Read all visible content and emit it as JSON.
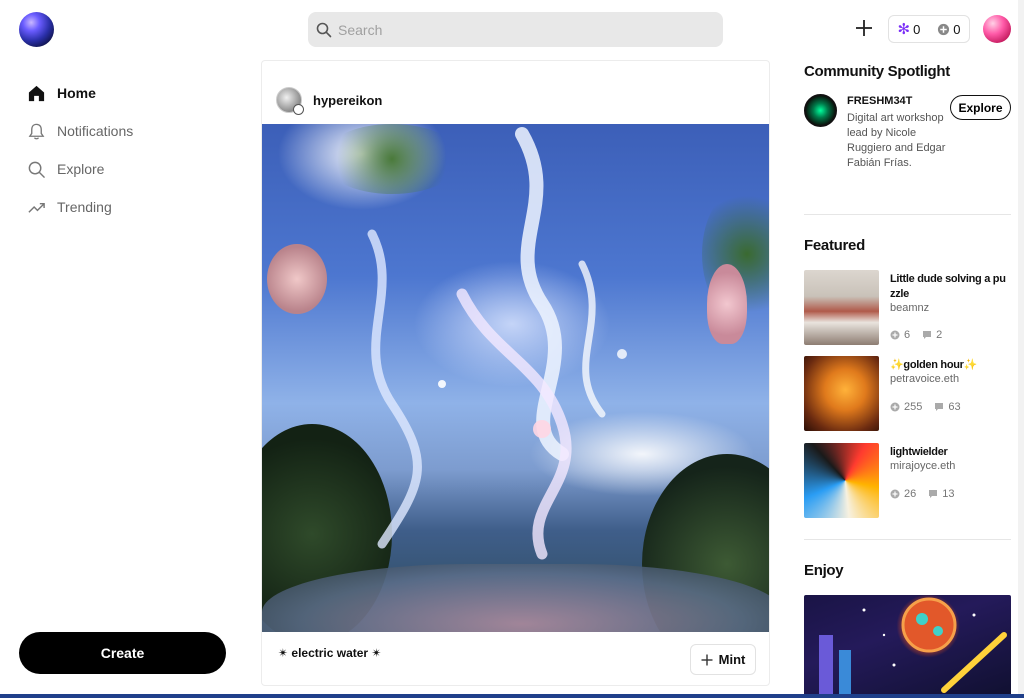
{
  "search": {
    "placeholder": "Search"
  },
  "header": {
    "stars_count": "0",
    "plus_count": "0"
  },
  "nav": {
    "items": [
      {
        "label": "Home",
        "icon": "home-icon",
        "active": true
      },
      {
        "label": "Notifications",
        "icon": "bell-icon",
        "active": false
      },
      {
        "label": "Explore",
        "icon": "search-icon",
        "active": false
      },
      {
        "label": "Trending",
        "icon": "trending-icon",
        "active": false
      }
    ],
    "create_label": "Create"
  },
  "post": {
    "username": "hypereikon",
    "caption": "✴ electric water ✴",
    "mint_label": "Mint"
  },
  "spotlight": {
    "title": "Community Spotlight",
    "name": "FRESHM34T",
    "description": "Digital art workshop lead by Nicole Ruggiero and Edgar Fabián Frías.",
    "explore_label": "Explore"
  },
  "featured": {
    "title": "Featured",
    "items": [
      {
        "title": "Little dude solving a puzzle",
        "author": "beamnz",
        "mints": "6",
        "comments": "2"
      },
      {
        "title": "✨golden hour✨",
        "author": "petravoice.eth",
        "mints": "255",
        "comments": "63"
      },
      {
        "title": "lightwielder",
        "author": "mirajoyce.eth",
        "mints": "26",
        "comments": "13"
      }
    ]
  },
  "enjoy": {
    "title": "Enjoy"
  },
  "colors": {
    "accent_star": "#7b2ff7",
    "button_dark": "#000000"
  }
}
